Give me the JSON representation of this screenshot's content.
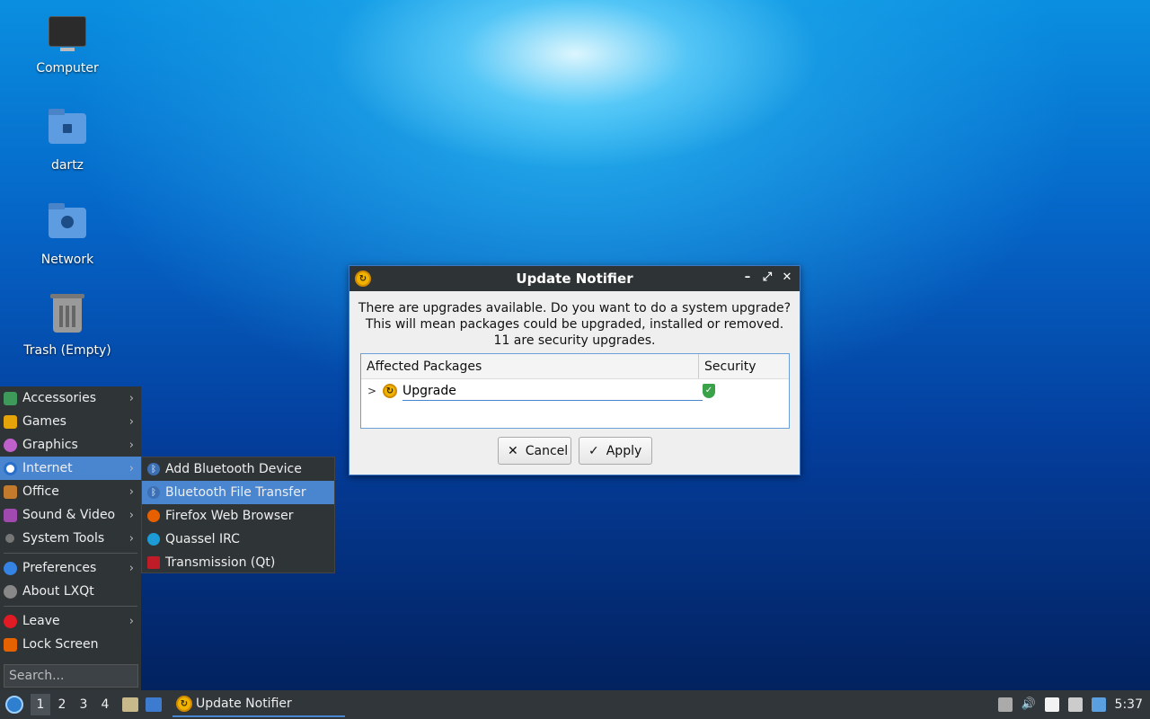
{
  "desktop": {
    "icons": [
      {
        "label": "Computer",
        "icon": "computer-icon"
      },
      {
        "label": "dartz",
        "icon": "home-folder-icon"
      },
      {
        "label": "Network",
        "icon": "network-folder-icon"
      },
      {
        "label": "Trash (Empty)",
        "icon": "trash-icon"
      }
    ]
  },
  "dialog": {
    "title": "Update Notifier",
    "message_line1": "There are upgrades available. Do you want to do a system upgrade?",
    "message_line2": "This will mean packages could be upgraded, installed or removed.",
    "message_line3": "11 are security upgrades.",
    "columns": [
      "Affected Packages",
      "Security"
    ],
    "package": "Upgrade",
    "cancel_label": "Cancel",
    "apply_label": "Apply"
  },
  "menu": {
    "items": [
      {
        "label": "Accessories",
        "color": "#3d9a5b"
      },
      {
        "label": "Games",
        "color": "#e5a50a"
      },
      {
        "label": "Graphics",
        "color": "#c061cb"
      },
      {
        "label": "Internet",
        "color": "#2a6fc9"
      },
      {
        "label": "Office",
        "color": "#c47a2c"
      },
      {
        "label": "Sound & Video",
        "color": "#a04ab0"
      },
      {
        "label": "System Tools",
        "color": "#777777"
      },
      {
        "label": "Preferences",
        "color": "#3584e4"
      },
      {
        "label": "About LXQt",
        "color": "#888888"
      },
      {
        "label": "Leave",
        "color": "#e01b24"
      },
      {
        "label": "Lock Screen",
        "color": "#e66100"
      }
    ],
    "search_placeholder": "Search..."
  },
  "submenu": {
    "items": [
      {
        "label": "Add Bluetooth Device",
        "color": "#3d6fb5"
      },
      {
        "label": "Bluetooth File Transfer",
        "color": "#3d6fb5"
      },
      {
        "label": "Firefox Web Browser",
        "color": "#e66000"
      },
      {
        "label": "Quassel IRC",
        "color": "#1c9bd6"
      },
      {
        "label": "Transmission (Qt)",
        "color": "#c01c28"
      }
    ]
  },
  "taskbar": {
    "workspaces": [
      "1",
      "2",
      "3",
      "4"
    ],
    "task_label": "Update Notifier",
    "clock": "5:37"
  }
}
